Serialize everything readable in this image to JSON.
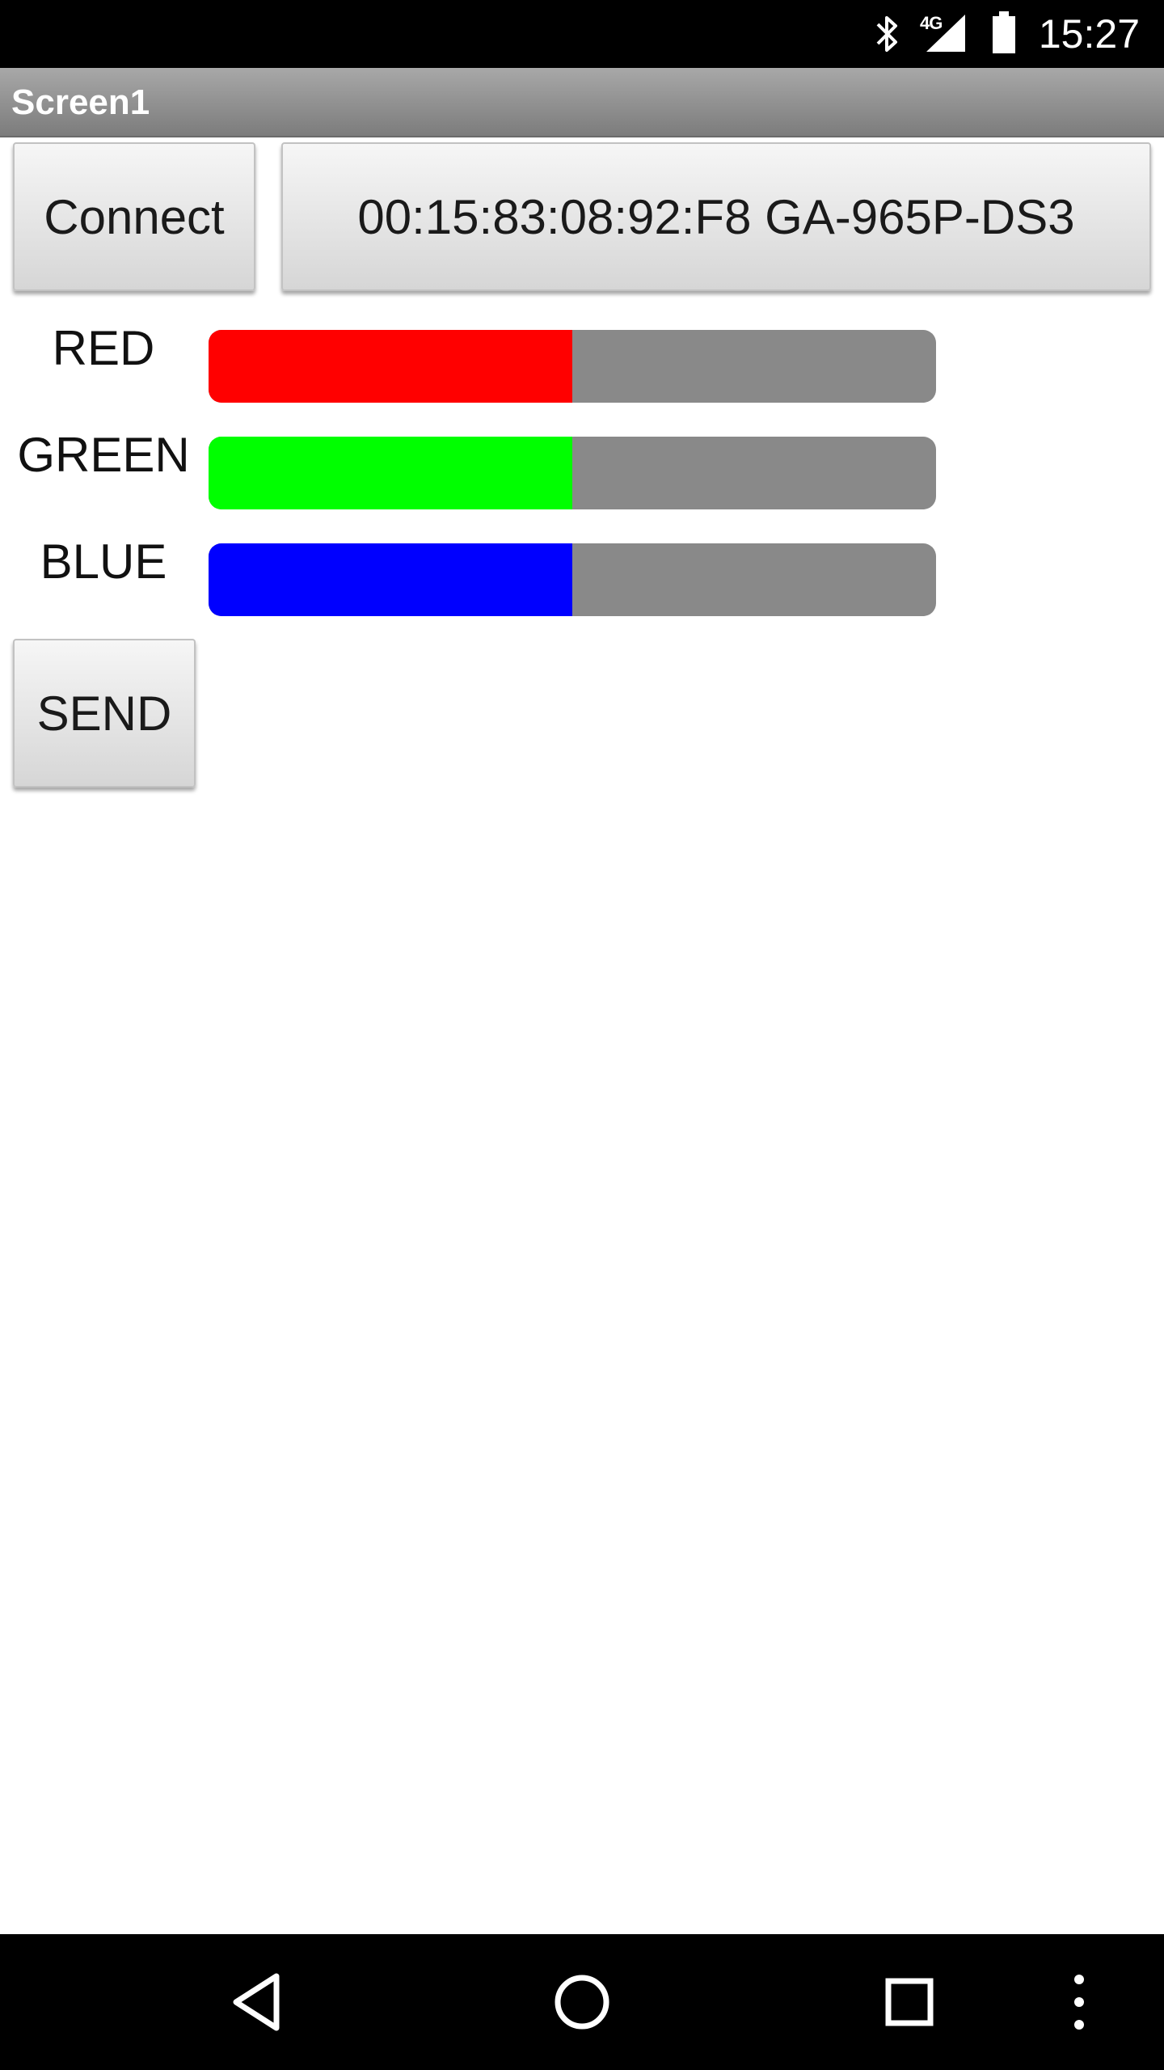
{
  "status_bar": {
    "network_type": "4G",
    "time": "15:27",
    "icons": [
      "bluetooth-icon",
      "signal-icon",
      "battery-icon"
    ]
  },
  "title_bar": {
    "title": "Screen1"
  },
  "buttons": {
    "connect_label": "Connect",
    "device_label": "00:15:83:08:92:F8 GA-965P-DS3",
    "send_label": "SEND"
  },
  "sliders": [
    {
      "label": "RED",
      "value_fraction": 0.5,
      "color": "#ff0000"
    },
    {
      "label": "GREEN",
      "value_fraction": 0.5,
      "color": "#00ff00"
    },
    {
      "label": "BLUE",
      "value_fraction": 0.5,
      "color": "#0000ff"
    }
  ],
  "slider_track_color": "#898989",
  "nav_bar": {
    "icons": [
      "back-icon",
      "home-icon",
      "recents-icon",
      "menu-icon"
    ]
  }
}
